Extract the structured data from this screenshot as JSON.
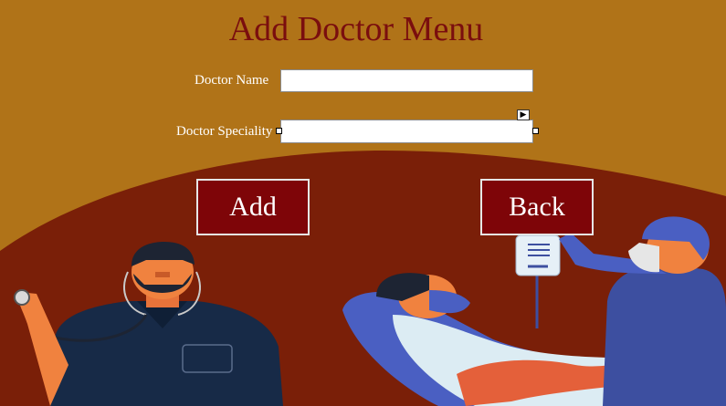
{
  "form": {
    "title": "Add Doctor Menu",
    "doctor_name_label": "Doctor Name",
    "doctor_name_value": "",
    "doctor_speciality_label": "Doctor Speciality",
    "doctor_speciality_value": ""
  },
  "buttons": {
    "add_label": "Add",
    "back_label": "Back"
  },
  "colors": {
    "background": "#b07318",
    "hill": "#7a1f08",
    "title": "#7a0e0e",
    "button_bg": "#7e0508"
  },
  "illustration": {
    "subject": "doctor-and-patient-illustration"
  }
}
